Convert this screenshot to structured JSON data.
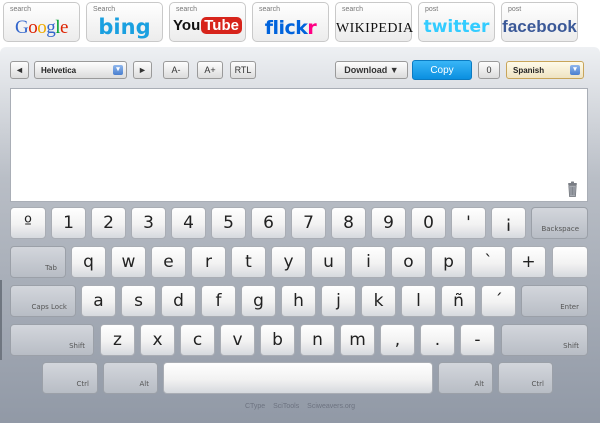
{
  "search_sites": [
    {
      "caption": "search",
      "name": "Google"
    },
    {
      "caption": "Search",
      "name": "bing"
    },
    {
      "caption": "search",
      "name_a": "You",
      "name_b": "Tube"
    },
    {
      "caption": "search",
      "name_a": "flick",
      "name_b": "r"
    },
    {
      "caption": "search",
      "name": "WIKIPEDIA"
    },
    {
      "caption": "post",
      "name": "twitter"
    },
    {
      "caption": "post",
      "name": "facebook"
    }
  ],
  "toolbar": {
    "prev": "◄",
    "font": "Helvetica",
    "next": "►",
    "font_smaller": "A-",
    "font_larger": "A+",
    "rtl": "RTL",
    "download": "Download ▼",
    "copy": "Copy",
    "count": "0",
    "language": "Spanish",
    "dropdown_arrow": "▾"
  },
  "keyboard": {
    "row1": [
      "º",
      "1",
      "2",
      "3",
      "4",
      "5",
      "6",
      "7",
      "8",
      "9",
      "0",
      "'",
      "¡"
    ],
    "backspace": "Backspace",
    "tab": "Tab",
    "row2": [
      "q",
      "w",
      "e",
      "r",
      "t",
      "y",
      "u",
      "i",
      "o",
      "p",
      "`",
      "+",
      ""
    ],
    "caps": "Caps Lock",
    "row3": [
      "a",
      "s",
      "d",
      "f",
      "g",
      "h",
      "j",
      "k",
      "l",
      "ñ",
      "´"
    ],
    "enter": "Enter",
    "shift": "Shift",
    "row4": [
      "z",
      "x",
      "c",
      "v",
      "b",
      "n",
      "m",
      ",",
      ".",
      "-"
    ],
    "ctrl": "Ctrl",
    "alt": "Alt",
    "space": ""
  },
  "footer": [
    "CType",
    "SciTools",
    "Sciweavers.org"
  ],
  "colors": {
    "google_letters": [
      "#3366cc",
      "#dd2200",
      "#eeaa00",
      "#3366cc",
      "#00a030",
      "#dd2200"
    ],
    "flickr_blue": "#0063dc",
    "flickr_pink": "#ff0084",
    "copy_blue": "#0a8fe0",
    "bing_blue": "#1aa0e0",
    "twitter_blue": "#33ccff",
    "facebook_blue": "#3b5998"
  },
  "icons": [
    "trash-icon",
    "prev-arrow-icon",
    "next-arrow-icon",
    "dropdown-icon"
  ]
}
